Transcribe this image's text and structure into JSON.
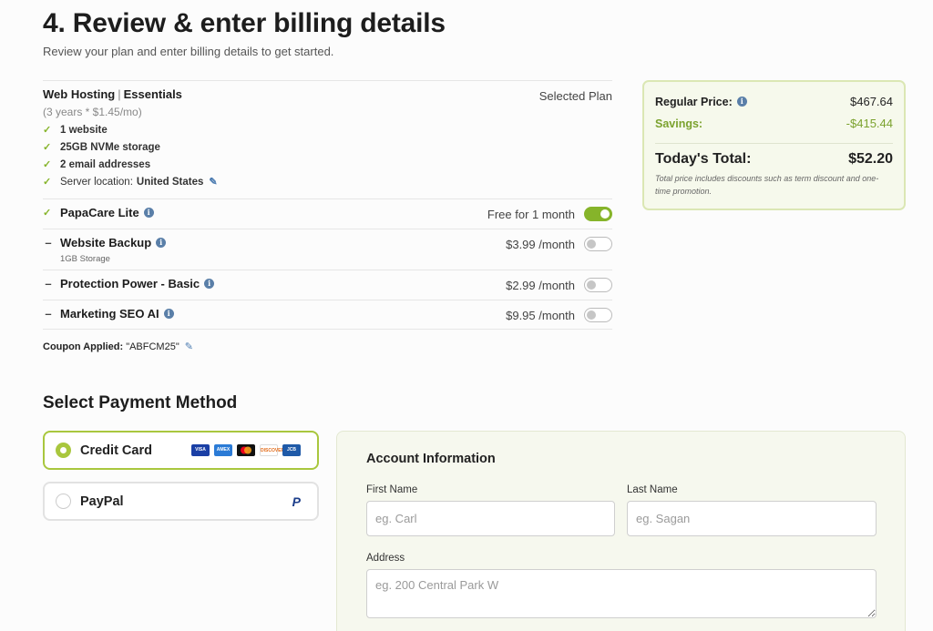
{
  "heading": "4. Review & enter billing details",
  "subheading": "Review your plan and enter billing details to get started.",
  "plan": {
    "product": "Web Hosting",
    "separator": "|",
    "tier": "Essentials",
    "selected_label": "Selected Plan",
    "term": "(3 years * $1.45/mo)",
    "features": [
      "1 website",
      "25GB NVMe storage",
      "2 email addresses"
    ],
    "server_location_label": "Server location:",
    "server_location_value": "United States"
  },
  "addons": [
    {
      "name": "PapaCare Lite",
      "price": "Free for 1 month",
      "enabled": true,
      "note": ""
    },
    {
      "name": "Website Backup",
      "price": "$3.99 /month",
      "enabled": false,
      "note": "1GB Storage"
    },
    {
      "name": "Protection Power - Basic",
      "price": "$2.99 /month",
      "enabled": false,
      "note": ""
    },
    {
      "name": "Marketing SEO AI",
      "price": "$9.95 /month",
      "enabled": false,
      "note": ""
    }
  ],
  "coupon": {
    "label": "Coupon Applied:",
    "code": "\"ABFCM25\""
  },
  "summary": {
    "regular_label": "Regular Price:",
    "regular_value": "$467.64",
    "savings_label": "Savings:",
    "savings_value": "-$415.44",
    "total_label": "Today's Total:",
    "total_value": "$52.20",
    "note": "Total price includes discounts such as term discount and one-time promotion."
  },
  "payment": {
    "title": "Select Payment Method",
    "methods": [
      {
        "label": "Credit Card",
        "selected": true
      },
      {
        "label": "PayPal",
        "selected": false
      }
    ],
    "card_brands": [
      "VISA",
      "AMEX",
      "MC",
      "DISCOVER",
      "JCB"
    ],
    "paypal_glyph": "P"
  },
  "account": {
    "title": "Account Information",
    "first_name_label": "First Name",
    "first_name_placeholder": "eg. Carl",
    "last_name_label": "Last Name",
    "last_name_placeholder": "eg. Sagan",
    "address_label": "Address",
    "address_placeholder": "eg. 200 Central Park W"
  },
  "colors": {
    "accent_green": "#86b42a",
    "info_blue": "#5a7fa8",
    "summary_bg": "#f6f9ec"
  }
}
